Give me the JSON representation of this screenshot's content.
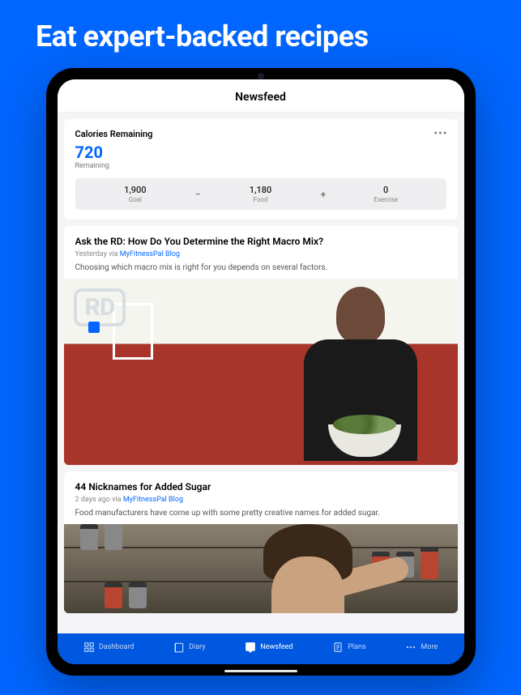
{
  "marketing_headline": "Eat expert-backed recipes",
  "app": {
    "title": "Newsfeed"
  },
  "calories": {
    "title": "Calories Remaining",
    "value": "720",
    "sub": "Remaining",
    "columns": {
      "goal": {
        "value": "1,900",
        "label": "Goal"
      },
      "food": {
        "value": "1,180",
        "label": "Food"
      },
      "exercise": {
        "value": "0",
        "label": "Exercise"
      }
    },
    "op_minus": "−",
    "op_plus": "+"
  },
  "articles": [
    {
      "title": "Ask the RD: How Do You Determine the Right Macro Mix?",
      "when": "Yesterday via ",
      "source": "MyFitnessPal Blog",
      "excerpt": "Choosing which macro mix is right for you depends on several factors.",
      "badge": "RD"
    },
    {
      "title": "44 Nicknames for Added Sugar",
      "when": "2 days ago via ",
      "source": "MyFitnessPal Blog",
      "excerpt": "Food manufacturers have come up with some pretty creative names for added sugar."
    }
  ],
  "nav": {
    "dashboard": "Dashboard",
    "diary": "Diary",
    "newsfeed": "Newsfeed",
    "plans": "Plans",
    "more": "More"
  }
}
